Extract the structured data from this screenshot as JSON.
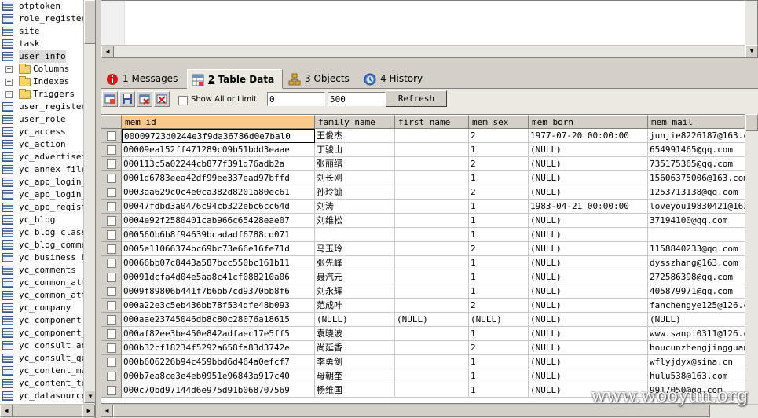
{
  "tree": {
    "items": [
      {
        "label": "otptoken",
        "kind": "table"
      },
      {
        "label": "role_register",
        "kind": "table"
      },
      {
        "label": "site",
        "kind": "table"
      },
      {
        "label": "task",
        "kind": "table"
      },
      {
        "label": "user_info",
        "kind": "table",
        "selected": true
      },
      {
        "label": "Columns",
        "kind": "folder"
      },
      {
        "label": "Indexes",
        "kind": "folder"
      },
      {
        "label": "Triggers",
        "kind": "folder"
      },
      {
        "label": "user_register",
        "kind": "table"
      },
      {
        "label": "user_role",
        "kind": "table"
      },
      {
        "label": "yc_access",
        "kind": "table"
      },
      {
        "label": "yc_action",
        "kind": "table"
      },
      {
        "label": "yc_advertiseme",
        "kind": "table"
      },
      {
        "label": "yc_annex_file",
        "kind": "table"
      },
      {
        "label": "yc_app_login_r",
        "kind": "table"
      },
      {
        "label": "yc_app_login_v",
        "kind": "table"
      },
      {
        "label": "yc_app_regist",
        "kind": "table"
      },
      {
        "label": "yc_blog",
        "kind": "table"
      },
      {
        "label": "yc_blog_class",
        "kind": "table"
      },
      {
        "label": "yc_blog_commer",
        "kind": "table"
      },
      {
        "label": "yc_business_bu",
        "kind": "table"
      },
      {
        "label": "yc_comments",
        "kind": "table"
      },
      {
        "label": "yc_common_attr",
        "kind": "table"
      },
      {
        "label": "yc_common_attr",
        "kind": "table"
      },
      {
        "label": "yc_company",
        "kind": "table"
      },
      {
        "label": "yc_component",
        "kind": "table"
      },
      {
        "label": "yc_component_s",
        "kind": "table"
      },
      {
        "label": "yc_consult_ans",
        "kind": "table"
      },
      {
        "label": "yc_consult_que",
        "kind": "table"
      },
      {
        "label": "yc_content_mar",
        "kind": "table"
      },
      {
        "label": "yc_content_tem",
        "kind": "table"
      },
      {
        "label": "yc_datasource",
        "kind": "table"
      }
    ]
  },
  "tabs": [
    {
      "num": "1",
      "label": "Messages",
      "icon": "info-icon"
    },
    {
      "num": "2",
      "label": "Table Data",
      "icon": "table-data-icon",
      "active": true
    },
    {
      "num": "3",
      "label": "Objects",
      "icon": "objects-icon"
    },
    {
      "num": "4",
      "label": "History",
      "icon": "history-icon"
    }
  ],
  "toolbar": {
    "show_all_label": "Show All or Limit",
    "limit_offset": "0",
    "limit_count": "500",
    "refresh_label": "Refresh"
  },
  "grid": {
    "columns": [
      "mem_id",
      "family_name",
      "first_name",
      "mem_sex",
      "mem_born",
      "mem_mail"
    ],
    "rows": [
      [
        "00009723d0244e3f9da36786d0e7bal0",
        "王俊杰",
        "",
        "2",
        "1977-07-20 00:00:00",
        "junjie8226187@163.c"
      ],
      [
        "00009eal52ff471289c09b51bdd3eaae",
        "丁骏山",
        "",
        "1",
        "(NULL)",
        "654991465@qq.com"
      ],
      [
        "000113c5a02244cb877f391d76adb2a",
        "张丽缙",
        "",
        "2",
        "(NULL)",
        "735175365@qq.com"
      ],
      [
        "0001d6783eea42df99ee337ead97bffd",
        "刘长刚",
        "",
        "1",
        "(NULL)",
        "15606375006@163.com"
      ],
      [
        "0003aa629c0c4e0ca382d8201a80ec61",
        "孙玲毓",
        "",
        "2",
        "(NULL)",
        "1253713138@qq.com"
      ],
      [
        "00047fdbd3a0476c94cb322ebc6cc64d",
        "刘涛",
        "",
        "1",
        "1983-04-21 00:00:00",
        "loveyou19830421@163"
      ],
      [
        "0004e92f2580401cab966c65428eae07",
        "刘维松",
        "",
        "1",
        "(NULL)",
        "37194100@qq.com"
      ],
      [
        "000560b6b8f94639bcadadf6788cd071",
        "",
        "",
        "1",
        "(NULL)",
        ""
      ],
      [
        "0005e11066374bc69bc73e66e16fe71d",
        "马玉玲",
        "",
        "2",
        "(NULL)",
        "1158840233@qq.com"
      ],
      [
        "00066bb07c8443a587bcc550bc161b11",
        "张先峰",
        "",
        "1",
        "(NULL)",
        "dysszhang@163.com"
      ],
      [
        "00091dcfa4d04e5aa8c41cf088210a06",
        "聂汽元",
        "",
        "1",
        "(NULL)",
        "272586398@qq.com"
      ],
      [
        "0009f89806b441f7b6bb7cd9370bb8f6",
        "刘永辉",
        "",
        "1",
        "(NULL)",
        "405879971@qq.com"
      ],
      [
        "000a22e3c5eb436bb78f534dfe48b093",
        "范成叶",
        "",
        "2",
        "(NULL)",
        "fanchengye125@126.c"
      ],
      [
        "000aae23745046db8c80c28076a18615",
        "(NULL)",
        "(NULL)",
        "(NULL)",
        "(NULL)",
        "(NULL)"
      ],
      [
        "000af82ee3be450e842adfaec17e5ff5",
        "袁晓波",
        "",
        "1",
        "(NULL)",
        "www.sanpi0311@126.c"
      ],
      [
        "000b32cf18234f5292a658fa83d3742e",
        "尚延香",
        "",
        "2",
        "(NULL)",
        "houcunzhengjingguan"
      ],
      [
        "000b606226b94c459bbd6d464a0efcf7",
        "李勇剑",
        "",
        "1",
        "(NULL)",
        "wflyjdyx@sina.cn"
      ],
      [
        "000b7ea8ce3e4eb0951e96843a917c40",
        "母朝奎",
        "",
        "1",
        "(NULL)",
        "hulu538@163.com"
      ],
      [
        "000c70bd97144d6e975d91b068707569",
        "杨维国",
        "",
        "1",
        "(NULL)",
        "9917050@qq.com"
      ]
    ]
  },
  "watermark": "www.wooyun.org",
  "colors": {
    "sorted_header": "#f8c98a",
    "chrome": "#d4d0c8",
    "tab_active": "#ece9e0"
  }
}
